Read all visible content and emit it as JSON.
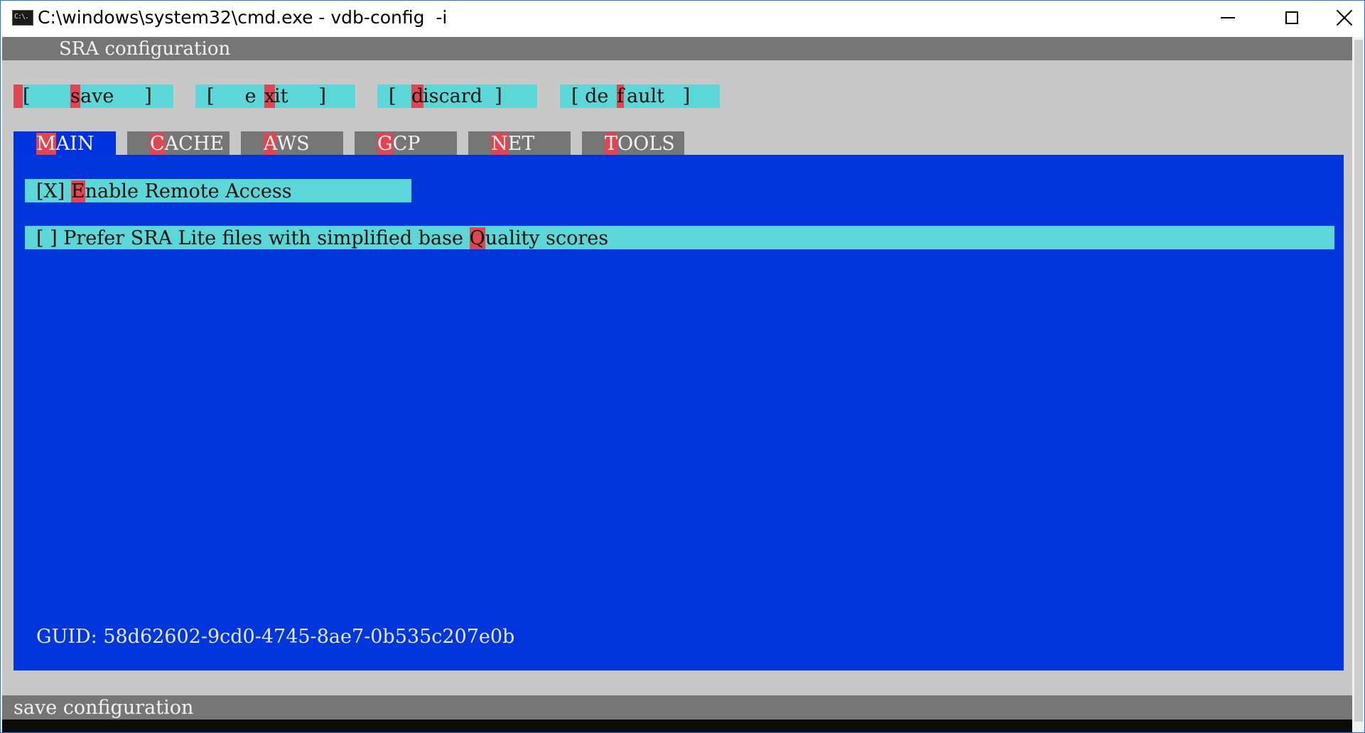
{
  "window": {
    "title": "C:\\windows\\system32\\cmd.exe - vdb-config  -i",
    "icon": "cmd-icon",
    "icon_text": "C:\\."
  },
  "colors": {
    "accent_cyan": "#5cd6d6",
    "panel_blue": "#0036dc",
    "hotkey_red": "#e04652",
    "bar_gray": "#767676",
    "console_gray": "#c8c8c8"
  },
  "heading": "SRA configuration",
  "buttons": [
    {
      "pre": "[     ",
      "key": "s",
      "post": "ave     ]"
    },
    {
      "pre": "[     e",
      "key": "x",
      "post": "it     ]"
    },
    {
      "pre": "[ ",
      "key": "d",
      "post": "iscard  ]"
    },
    {
      "pre": "[ de",
      "key": "f",
      "post": "ault   ]"
    }
  ],
  "tabs": [
    {
      "key": "M",
      "rest": "AIN",
      "active": true
    },
    {
      "key": "C",
      "rest": "ACHE",
      "active": false
    },
    {
      "key": "A",
      "rest": "WS",
      "active": false
    },
    {
      "key": "G",
      "rest": "CP",
      "active": false
    },
    {
      "key": "N",
      "rest": "ET",
      "active": false
    },
    {
      "key": "T",
      "rest": "OOLS",
      "active": false
    }
  ],
  "options": {
    "remote": {
      "box": "[X] ",
      "pre": "",
      "key": "E",
      "post": "nable Remote Access",
      "checked": true
    },
    "lite": {
      "box": "[ ] ",
      "pre": "Prefer SRA Lite files with simplified base ",
      "key": "Q",
      "post": "uality scores",
      "checked": false
    }
  },
  "guid": "GUID: 58d62602-9cd0-4745-8ae7-0b535c207e0b",
  "status": "save configuration"
}
